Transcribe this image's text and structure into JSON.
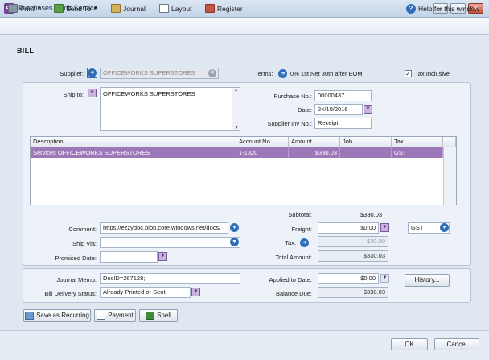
{
  "window": {
    "title": "Purchases - Edit Service",
    "app_icon_text": "Ab"
  },
  "toolbar": {
    "print": "Print",
    "send_to": "Send To",
    "journal": "Journal",
    "layout": "Layout",
    "register": "Register",
    "help": "Help for this window"
  },
  "section_title": "BILL",
  "supplier": {
    "label": "Supplier:",
    "value": "OFFICEWORKS SUPERSTORES",
    "terms_label": "Terms:",
    "terms_value": "0% 1st Net 30th after EOM",
    "tax_inclusive_label": "Tax Inclusive",
    "tax_inclusive_checked": "✓"
  },
  "ship_to": {
    "label": "Ship to:",
    "value": "OFFICEWORKS SUPERSTORES"
  },
  "purchase": {
    "purchase_no_label": "Purchase No.:",
    "purchase_no": "00000437",
    "date_label": "Date:",
    "date": "24/10/2016",
    "supplier_inv_label": "Supplier Inv No.:",
    "supplier_inv": "Receipt"
  },
  "grid": {
    "columns": [
      "Description",
      "Account No.",
      "Amount",
      "Job",
      "Tax"
    ],
    "rows": [
      {
        "description": "Services OFFICEWORKS SUPERSTORES",
        "account": "1-1320",
        "amount": "$330.03",
        "job": "",
        "tax": "GST"
      }
    ]
  },
  "totals": {
    "subtotal_label": "Subtotal:",
    "subtotal": "$330.03",
    "freight_label": "Freight:",
    "freight": "$0.00",
    "freight_tax": "GST",
    "tax_label": "Tax:",
    "tax": "$30.00",
    "total_label": "Total Amount:",
    "total": "$330.03"
  },
  "details": {
    "comment_label": "Comment:",
    "comment": "https://ezzydoc.blob.core.windows.net/docs/",
    "ship_via_label": "Ship Via:",
    "ship_via": "",
    "promised_label": "Promised Date:",
    "promised": ""
  },
  "journal": {
    "memo_label": "Journal Memo:",
    "memo": "DocID=267128;",
    "delivery_label": "Bill Delivery Status:",
    "delivery": "Already Printed or Sent",
    "applied_label": "Applied to Date:",
    "applied": "$0.00",
    "balance_label": "Balance Due:",
    "balance": "$330.03",
    "history_button": "History..."
  },
  "actions": {
    "save_recurring": "Save as Recurring",
    "payment": "Payment",
    "spell": "Spell"
  },
  "footer": {
    "ok": "OK",
    "cancel": "Cancel"
  },
  "colors": {
    "selected_row": "#9c78b8",
    "accent_blue": "#2f6fb8"
  }
}
